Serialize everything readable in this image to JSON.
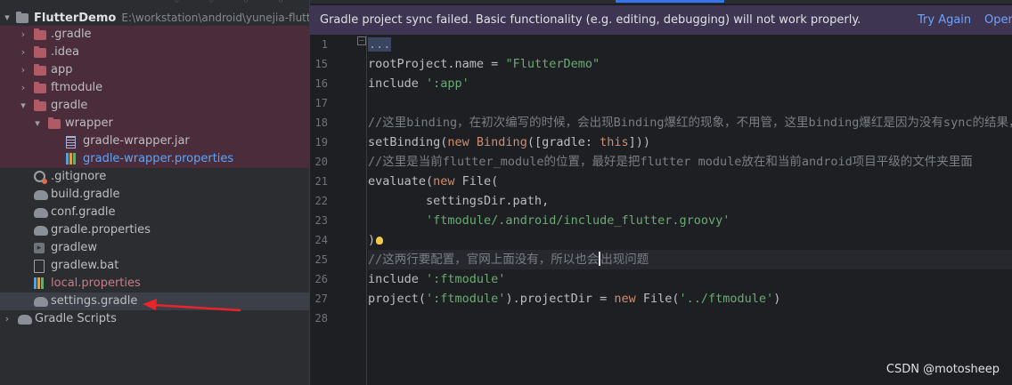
{
  "project": {
    "name": "FlutterDemo",
    "path": "E:\\workstation\\android\\yunejia-flutter-"
  },
  "tree": [
    {
      "label": ".gradle",
      "icon": "folder-icon",
      "depth": 1,
      "expanded": false,
      "excluded": true
    },
    {
      "label": ".idea",
      "icon": "folder-icon",
      "depth": 1,
      "expanded": false,
      "excluded": true
    },
    {
      "label": "app",
      "icon": "folder-icon",
      "depth": 1,
      "expanded": false,
      "excluded": true
    },
    {
      "label": "ftmodule",
      "icon": "folder-icon",
      "depth": 1,
      "expanded": false,
      "excluded": true
    },
    {
      "label": "gradle",
      "icon": "folder-icon",
      "depth": 1,
      "expanded": true,
      "excluded": true
    },
    {
      "label": "wrapper",
      "icon": "folder-icon",
      "depth": 2,
      "expanded": true,
      "excluded": true
    },
    {
      "label": "gradle-wrapper.jar",
      "icon": "jar-file-icon",
      "depth": 3,
      "excluded": true
    },
    {
      "label": "gradle-wrapper.properties",
      "icon": "properties-file-icon",
      "depth": 3,
      "excluded": true,
      "color": "blue"
    },
    {
      "label": ".gitignore",
      "icon": "gitignore-file-icon",
      "depth": 1
    },
    {
      "label": "build.gradle",
      "icon": "gradle-file-icon",
      "depth": 1
    },
    {
      "label": "conf.gradle",
      "icon": "gradle-file-icon",
      "depth": 1
    },
    {
      "label": "gradle.properties",
      "icon": "gradle-file-icon",
      "depth": 1
    },
    {
      "label": "gradlew",
      "icon": "script-file-icon",
      "depth": 1
    },
    {
      "label": "gradlew.bat",
      "icon": "text-file-icon",
      "depth": 1
    },
    {
      "label": "local.properties",
      "icon": "properties-file-icon",
      "depth": 1,
      "color": "red"
    },
    {
      "label": "settings.gradle",
      "icon": "gradle-file-icon",
      "depth": 1,
      "selected": true
    },
    {
      "label": "Gradle Scripts",
      "icon": "gradle-scripts-icon",
      "depth": 0,
      "expanded": false
    }
  ],
  "banner": {
    "message": "Gradle project sync failed. Basic functionality (e.g. editing, debugging) will not work properly.",
    "try_again": "Try Again",
    "open": "Open"
  },
  "line_numbers": [
    "1",
    "15",
    "16",
    "17",
    "18",
    "19",
    "20",
    "21",
    "22",
    "23",
    "24",
    "25",
    "26",
    "27",
    "28"
  ],
  "code_lines": [
    [
      {
        "t": "...",
        "c": "fold"
      }
    ],
    [
      {
        "t": "rootProject.name = ",
        "c": "t"
      },
      {
        "t": "\"FlutterDemo\"",
        "c": "s"
      }
    ],
    [
      {
        "t": "include ",
        "c": "t"
      },
      {
        "t": "':app'",
        "c": "s"
      }
    ],
    [],
    [
      {
        "t": "//这里binding，在初次编写的时候，会出现Binding爆红的现象，不用管，这里binding爆红是因为没有sync的结果，如",
        "c": "c"
      }
    ],
    [
      {
        "t": "setBinding(",
        "c": "t"
      },
      {
        "t": "new ",
        "c": "k"
      },
      {
        "t": "Binding",
        "c": "k"
      },
      {
        "t": "([gradle: ",
        "c": "t"
      },
      {
        "t": "this",
        "c": "k"
      },
      {
        "t": "]))",
        "c": "t"
      }
    ],
    [
      {
        "t": "//这里是当前flutter_module的位置，最好是把flutter module放在和当前android项目平级的文件夹里面",
        "c": "c"
      }
    ],
    [
      {
        "t": "evaluate(",
        "c": "t"
      },
      {
        "t": "new ",
        "c": "k"
      },
      {
        "t": "File(",
        "c": "t"
      }
    ],
    [
      {
        "t": "        settingsDir.path,",
        "c": "t"
      }
    ],
    [
      {
        "t": "        ",
        "c": "t"
      },
      {
        "t": "'ftmodule/.android/include_flutter.groovy'",
        "c": "s"
      }
    ],
    [
      {
        "t": ")",
        "c": "t"
      },
      {
        "t": "",
        "c": "bulb"
      }
    ],
    [
      {
        "t": "//这两行要配置，官网上面没有，所以也会",
        "c": "c"
      },
      {
        "t": "",
        "c": "caret"
      },
      {
        "t": "出现问题",
        "c": "c"
      }
    ],
    [
      {
        "t": "include ",
        "c": "t"
      },
      {
        "t": "':ftmodule'",
        "c": "s"
      }
    ],
    [
      {
        "t": "project(",
        "c": "t"
      },
      {
        "t": "':ftmodule'",
        "c": "s"
      },
      {
        "t": ").projectDir = ",
        "c": "t"
      },
      {
        "t": "new ",
        "c": "k"
      },
      {
        "t": "File(",
        "c": "t"
      },
      {
        "t": "'../ftmodule'",
        "c": "s"
      },
      {
        "t": ")",
        "c": "t"
      }
    ],
    []
  ],
  "caret_line_index": 11,
  "watermark": "CSDN @motosheep",
  "colors": {
    "excluded_bg": "#4a2c3a",
    "banner_bg": "#3d3552",
    "link": "#6fa3ff",
    "string": "#6aab73",
    "keyword": "#cf8e6d",
    "comment": "#7a7e85",
    "annotation_arrow": "#e8252b"
  }
}
